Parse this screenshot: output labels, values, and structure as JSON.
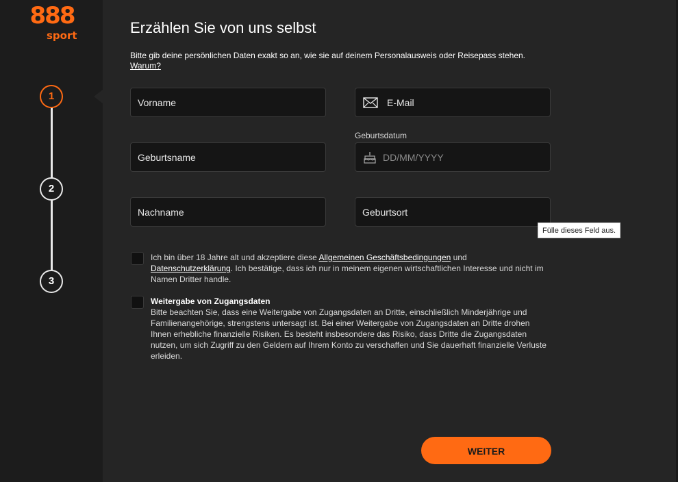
{
  "brand": {
    "logo_digits": "888",
    "logo_sub": "sport",
    "accent_color": "#ff6a13"
  },
  "steps": [
    {
      "number": "1",
      "state": "active"
    },
    {
      "number": "2",
      "state": "pending"
    },
    {
      "number": "3",
      "state": "pending"
    }
  ],
  "header": {
    "title": "Erzählen Sie von uns selbst",
    "intro_text": "Bitte gib deine persönlichen Daten exakt so an, wie sie auf deinem Personalausweis oder Reisepass stehen.",
    "intro_link": "Warum?"
  },
  "form": {
    "first_name_placeholder": "Vorname",
    "email_placeholder": "E-Mail",
    "email_icon": "envelope-icon",
    "birth_name_placeholder": "Geburtsname",
    "birthdate_label": "Geburtsdatum",
    "birthdate_placeholder": "DD/MM/YYYY",
    "birthdate_icon": "birthday-cake-icon",
    "last_name_placeholder": "Nachname",
    "birthplace_placeholder": "Geburtsort",
    "tooltip": "Fülle dieses Feld aus."
  },
  "consent": {
    "terms_prefix": "Ich bin über 18 Jahre alt und akzeptiere diese ",
    "terms_link": "Allgemeinen Geschäftsbedingungen",
    "terms_and": " und ",
    "privacy_link": "Datenschutzerklärung",
    "terms_suffix": ". Ich bestätige, dass ich nur in meinem eigenen wirtschaftlichen Interesse und nicht im Namen Dritter handle.",
    "sharing_title": "Weitergabe von Zugangsdaten",
    "sharing_text": "Bitte beachten Sie, dass eine Weitergabe von Zugangsdaten an Dritte, einschließlich Minderjährige und Familienangehörige, strengstens untersagt ist. Bei einer Weitergabe von Zugangsdaten an Dritte drohen Ihnen erhebliche finanzielle Risiken. Es besteht insbesondere das Risiko, dass Dritte die Zugangsdaten nutzen, um sich Zugriff zu den Geldern auf Ihrem Konto zu verschaffen und Sie dauerhaft finanzielle Verluste erleiden."
  },
  "actions": {
    "next_label": "WEITER"
  }
}
